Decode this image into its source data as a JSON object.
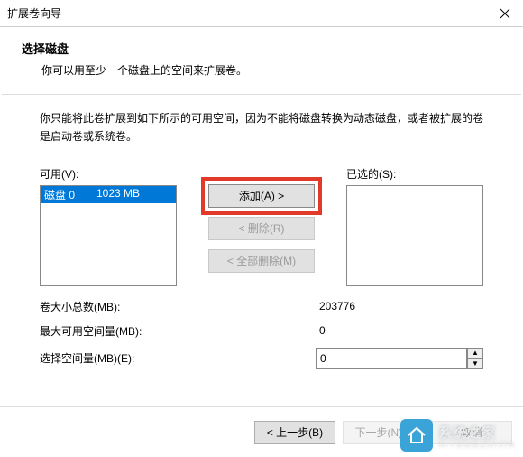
{
  "window": {
    "title": "扩展卷向导"
  },
  "header": {
    "heading": "选择磁盘",
    "description": "你可以用至少一个磁盘上的空间来扩展卷。"
  },
  "notice": "你只能将此卷扩展到如下所示的可用空间，因为不能将磁盘转换为动态磁盘，或者被扩展的卷是启动卷或系统卷。",
  "available": {
    "label": "可用(V):",
    "items": [
      {
        "disk": "磁盘 0",
        "size": "1023 MB"
      }
    ]
  },
  "selected": {
    "label": "已选的(S):",
    "items": []
  },
  "buttons": {
    "add": "添加(A) >",
    "remove": "< 删除(R)",
    "remove_all": "< 全部删除(M)",
    "back": "< 上一步(B)",
    "next": "下一步(N) >",
    "cancel": "取消"
  },
  "fields": {
    "total_label": "卷大小总数(MB):",
    "total_value": "203776",
    "max_label": "最大可用空间量(MB):",
    "max_value": "0",
    "select_label": "选择空间量(MB)(E):",
    "select_value": "0"
  },
  "watermark": {
    "brand": "系统之家",
    "sub": "XITONGZHIJIA"
  }
}
